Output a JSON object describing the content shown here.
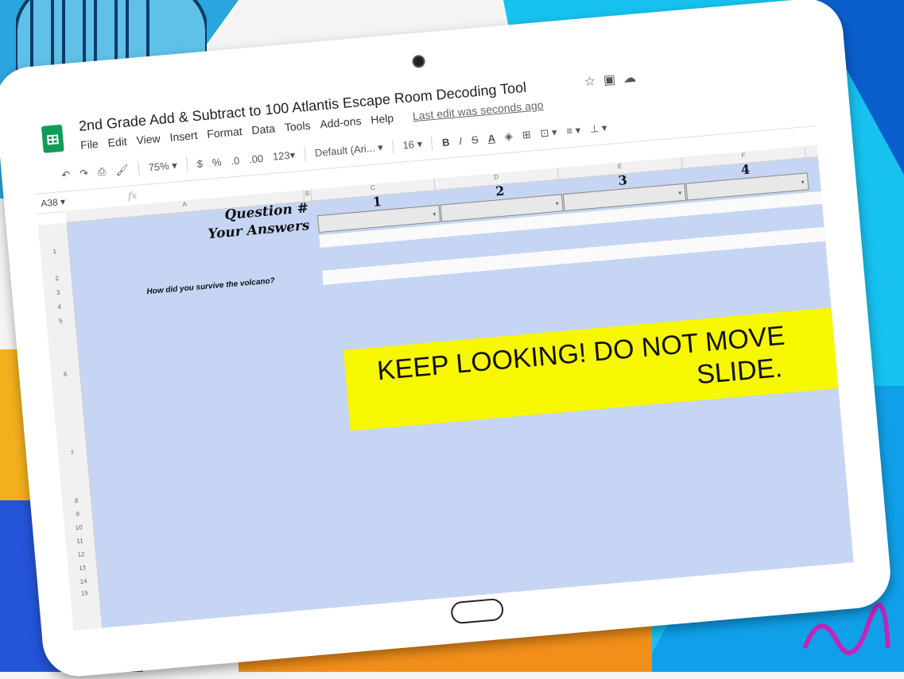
{
  "app": {
    "doc_title": "2nd Grade Add & Subtract to 100 Atlantis Escape Room Decoding Tool",
    "title_icons": [
      "star-icon",
      "move-to-folder-icon",
      "cloud-status-icon"
    ]
  },
  "menu": {
    "items": [
      "File",
      "Edit",
      "View",
      "Insert",
      "Format",
      "Data",
      "Tools",
      "Add-ons",
      "Help"
    ],
    "last_edit": "Last edit was seconds ago"
  },
  "toolbar": {
    "zoom": "75%",
    "currency": "$",
    "percent": "%",
    "dec_decrease": ".0",
    "dec_increase": ".00",
    "number_format": "123",
    "font": "Default (Ari...",
    "font_size": "16",
    "bold": "B",
    "italic": "I",
    "strike": "S",
    "text_color": "A"
  },
  "formula_bar": {
    "cell_ref": "A38",
    "fx": "fx"
  },
  "columns": [
    "A",
    "B",
    "C",
    "D",
    "E",
    "F"
  ],
  "rows": [
    "1",
    "2",
    "3",
    "4",
    "5",
    "6",
    "7",
    "8",
    "9",
    "10",
    "11",
    "12",
    "13",
    "14",
    "15"
  ],
  "sheet": {
    "question_label": "Question #",
    "answers_label": "Your Answers",
    "questions": [
      "1",
      "2",
      "3",
      "4"
    ],
    "volcano_prompt": "How did you survive the volcano?",
    "banner_line1": "KEEP LOOKING! DO NOT MOVE",
    "banner_line2": "SLIDE."
  },
  "colors": {
    "sheet_bg": "#c5d5f3",
    "banner_bg": "#f7f700",
    "sheets_green": "#0f9d58"
  }
}
